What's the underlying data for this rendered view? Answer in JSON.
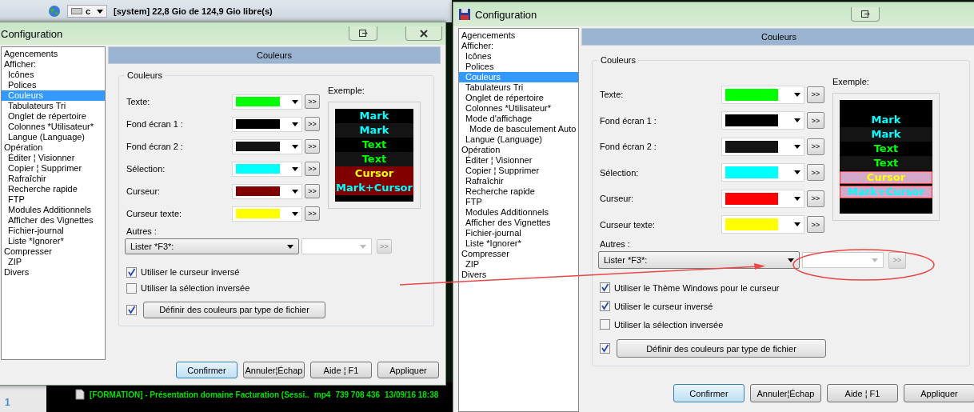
{
  "background": {
    "drive_bar": {
      "drive": "c",
      "info": "[system]  22,8 Gio de 124,9 Gio libre(s)"
    },
    "panel_number": "1",
    "file_rows": [
      {
        "name": "[FORMATION] - Présentation domaine Facturation (Sessi..",
        "ext": "mp4",
        "size": "739 708 436",
        "date": "13/09/16 18:38"
      }
    ]
  },
  "windows": [
    {
      "title": "Configuration",
      "sidebar": [
        {
          "label": "Agencements",
          "selected": false
        },
        {
          "label": "Afficher:",
          "selected": false,
          "children": [
            {
              "label": "Icônes",
              "selected": false
            },
            {
              "label": "Polices",
              "selected": false
            },
            {
              "label": "Couleurs",
              "selected": true
            },
            {
              "label": "Tabulateurs Tri",
              "selected": false
            },
            {
              "label": "Onglet de répertoire",
              "selected": false
            },
            {
              "label": "Colonnes *Utilisateur*",
              "selected": false
            },
            {
              "label": "Langue (Language)",
              "selected": false
            }
          ]
        },
        {
          "label": "Opération",
          "selected": false,
          "children": [
            {
              "label": "Éditer ¦ Visionner",
              "selected": false
            },
            {
              "label": "Copier ¦ Supprimer",
              "selected": false
            },
            {
              "label": "Rafraîchir",
              "selected": false
            },
            {
              "label": "Recherche rapide",
              "selected": false
            },
            {
              "label": "FTP",
              "selected": false
            },
            {
              "label": "Modules Additionnels",
              "selected": false
            },
            {
              "label": "Afficher des Vignettes",
              "selected": false
            },
            {
              "label": "Fichier-journal",
              "selected": false
            },
            {
              "label": "Liste *Ignorer*",
              "selected": false
            }
          ]
        },
        {
          "label": "Compresser",
          "selected": false,
          "children": [
            {
              "label": "ZIP",
              "selected": false
            }
          ]
        },
        {
          "label": "Divers",
          "selected": false
        }
      ],
      "header": "Couleurs",
      "group_title": "Couleurs",
      "color_rows": [
        {
          "label": "Texte:",
          "color": "#00ff00",
          "button": ">>"
        },
        {
          "label": "Fond écran 1 :",
          "color": "#000000",
          "button": ">>"
        },
        {
          "label": "Fond écran 2 :",
          "color": "#141414",
          "button": ">>"
        },
        {
          "label": "Sélection:",
          "color": "#00ffff",
          "button": ">>"
        },
        {
          "label": "Curseur:",
          "color": "#800000",
          "button": ">>"
        },
        {
          "label": "Curseur texte:",
          "color": "#ffff00",
          "button": ">>"
        }
      ],
      "example_label": "Exemple:",
      "example_lines": [
        {
          "text": "Mark",
          "kind": "mark",
          "outlined": false
        },
        {
          "text": "Mark",
          "kind": "mark_alt",
          "outlined": false
        },
        {
          "text": "Text",
          "kind": "text",
          "outlined": false
        },
        {
          "text": "Text",
          "kind": "text_alt",
          "outlined": false
        },
        {
          "text": "Cursor",
          "kind": "cursor",
          "outlined": false
        },
        {
          "text": "Mark+Cursor",
          "kind": "mark_cursor",
          "outlined": false
        }
      ],
      "others_label": "Autres :",
      "others_select": "Lister *F3*:",
      "others_button": ">>",
      "checkboxes": [
        {
          "label": "Utiliser le curseur inversé",
          "checked": true
        },
        {
          "label": "Utiliser la sélection inversée",
          "checked": false
        }
      ],
      "define": {
        "checked": true,
        "label": "Définir des couleurs par type de fichier"
      },
      "buttons": [
        {
          "label": "Confirmer",
          "default": true
        },
        {
          "label": "Annuler¦Échap",
          "default": false
        },
        {
          "label": "Aide ¦ F1",
          "default": false
        },
        {
          "label": "Appliquer",
          "default": false
        }
      ]
    },
    {
      "title": "Configuration",
      "sidebar": [
        {
          "label": "Agencements",
          "selected": false
        },
        {
          "label": "Afficher:",
          "selected": false,
          "children": [
            {
              "label": "Icônes",
              "selected": false
            },
            {
              "label": "Polices",
              "selected": false
            },
            {
              "label": "Couleurs",
              "selected": true
            },
            {
              "label": "Tabulateurs Tri",
              "selected": false
            },
            {
              "label": "Onglet de répertoire",
              "selected": false
            },
            {
              "label": "Colonnes *Utilisateur*",
              "selected": false
            },
            {
              "label": "Mode d'affichage",
              "selected": false,
              "children": [
                {
                  "label": "Mode de basculement Auto",
                  "selected": false
                }
              ]
            },
            {
              "label": "Langue (Language)",
              "selected": false
            }
          ]
        },
        {
          "label": "Opération",
          "selected": false,
          "children": [
            {
              "label": "Éditer ¦ Visionner",
              "selected": false
            },
            {
              "label": "Copier ¦ Supprimer",
              "selected": false
            },
            {
              "label": "Rafraîchir",
              "selected": false
            },
            {
              "label": "Recherche rapide",
              "selected": false
            },
            {
              "label": "FTP",
              "selected": false
            },
            {
              "label": "Modules Additionnels",
              "selected": false
            },
            {
              "label": "Afficher des Vignettes",
              "selected": false
            },
            {
              "label": "Fichier-journal",
              "selected": false
            },
            {
              "label": "Liste *Ignorer*",
              "selected": false
            }
          ]
        },
        {
          "label": "Compresser",
          "selected": false,
          "children": [
            {
              "label": "ZIP",
              "selected": false
            }
          ]
        },
        {
          "label": "Divers",
          "selected": false
        }
      ],
      "header": "Couleurs",
      "group_title": "Couleurs",
      "color_rows": [
        {
          "label": "Texte:",
          "color": "#00ff00",
          "button": ">>"
        },
        {
          "label": "Fond écran 1 :",
          "color": "#000000",
          "button": ">>"
        },
        {
          "label": "Fond écran 2 :",
          "color": "#141414",
          "button": ">>"
        },
        {
          "label": "Sélection:",
          "color": "#00ffff",
          "button": ">>"
        },
        {
          "label": "Curseur:",
          "color": "#ff0000",
          "button": ">>"
        },
        {
          "label": "Curseur texte:",
          "color": "#ffff00",
          "button": ">>"
        }
      ],
      "example_label": "Exemple:",
      "example_lines": [
        {
          "text": "Mark",
          "kind": "mark",
          "outlined": false
        },
        {
          "text": "Mark",
          "kind": "mark_alt",
          "outlined": false
        },
        {
          "text": "Text",
          "kind": "text",
          "outlined": false
        },
        {
          "text": "Text",
          "kind": "text_alt",
          "outlined": false
        },
        {
          "text": "Cursor",
          "kind": "cursor",
          "outlined": true
        },
        {
          "text": "Mark+Cursor",
          "kind": "mark_cursor",
          "outlined": true
        }
      ],
      "others_label": "Autres :",
      "others_select": "Lister *F3*:",
      "others_button": ">>",
      "checkboxes": [
        {
          "label": "Utiliser le Thème Windows pour le curseur",
          "checked": true
        },
        {
          "label": "Utiliser le curseur inversé",
          "checked": true
        },
        {
          "label": "Utiliser la sélection inversée",
          "checked": false
        }
      ],
      "define": {
        "checked": true,
        "label": "Définir des couleurs par type de fichier"
      },
      "buttons": [
        {
          "label": "Confirmer",
          "default": true
        },
        {
          "label": "Annuler¦Échap",
          "default": false
        },
        {
          "label": "Aide ¦ F1",
          "default": false
        },
        {
          "label": "Appliquer",
          "default": false
        }
      ]
    }
  ]
}
